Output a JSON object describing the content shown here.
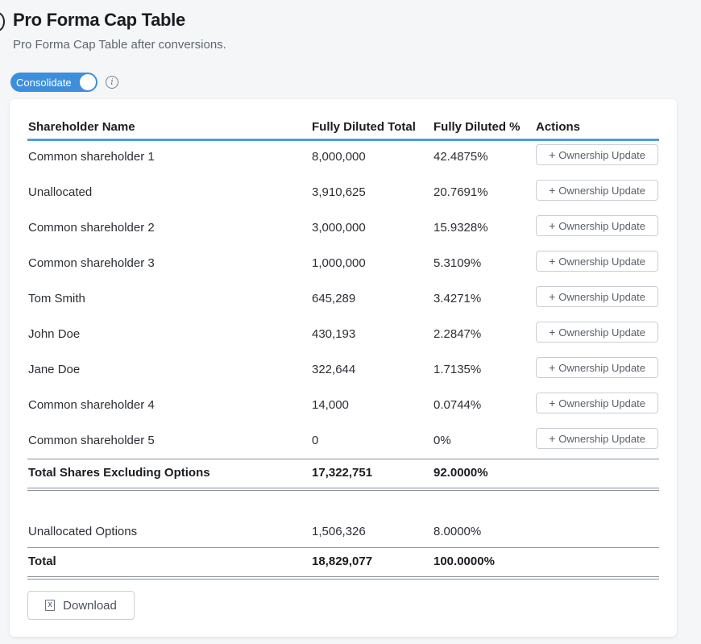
{
  "header": {
    "title": "Pro Forma Cap Table",
    "subtitle": "Pro Forma Cap Table after conversions."
  },
  "consolidate_toggle": {
    "label": "Consolidate",
    "state": "on",
    "color": "#3d8fdc"
  },
  "table": {
    "columns": [
      "Shareholder Name",
      "Fully Diluted Total",
      "Fully Diluted %",
      "Actions"
    ],
    "action_label": "Ownership Update",
    "rows": [
      {
        "name": "Common shareholder 1",
        "total": "8,000,000",
        "pct": "42.4875%"
      },
      {
        "name": "Unallocated",
        "total": "3,910,625",
        "pct": "20.7691%"
      },
      {
        "name": "Common shareholder 2",
        "total": "3,000,000",
        "pct": "15.9328%"
      },
      {
        "name": "Common shareholder 3",
        "total": "1,000,000",
        "pct": "5.3109%"
      },
      {
        "name": "Tom Smith",
        "total": "645,289",
        "pct": "3.4271%"
      },
      {
        "name": "John Doe",
        "total": "430,193",
        "pct": "2.2847%"
      },
      {
        "name": "Jane Doe",
        "total": "322,644",
        "pct": "1.7135%"
      },
      {
        "name": "Common shareholder 4",
        "total": "14,000",
        "pct": "0.0744%"
      },
      {
        "name": "Common shareholder 5",
        "total": "0",
        "pct": "0%"
      }
    ],
    "subtotal": {
      "name": "Total Shares Excluding Options",
      "total": "17,322,751",
      "pct": "92.0000%"
    },
    "options": {
      "name": "Unallocated Options",
      "total": "1,506,326",
      "pct": "8.0000%"
    },
    "grand_total": {
      "name": "Total",
      "total": "18,829,077",
      "pct": "100.0000%"
    }
  },
  "download_button": {
    "label": "Download",
    "icon": "excel-file-icon"
  }
}
